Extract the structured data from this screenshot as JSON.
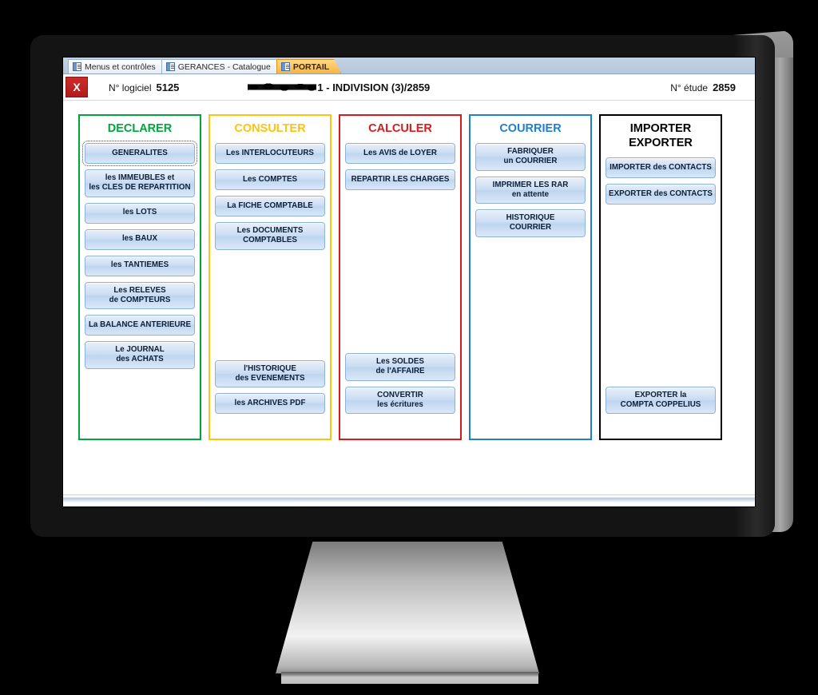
{
  "window": {
    "doc_tabs": [
      {
        "label": "Menus et contrôles",
        "active": false
      },
      {
        "label": "GERANCES - Catalogue",
        "active": false
      },
      {
        "label": "PORTAIL",
        "active": true
      }
    ],
    "close_button_label": "X",
    "header": {
      "software_label": "N° logiciel",
      "software_value": "5125",
      "title_redacted_suffix": "1 - INDIVISION (3)/2859",
      "study_label": "N° étude",
      "study_value": "2859"
    }
  },
  "panels": [
    {
      "title": "DECLARER",
      "color": "#00a63c",
      "title_color": "#00a63c",
      "buttons": [
        {
          "label": "GENERALITES",
          "focused": true
        },
        {
          "label": "les IMMEUBLES et\nles CLES DE REPARTITION",
          "focused": false
        },
        {
          "label": "les LOTS",
          "focused": false
        },
        {
          "label": "les BAUX",
          "focused": false
        },
        {
          "label": "les TANTIEMES",
          "focused": false
        },
        {
          "label": "Les RELEVES\nde COMPTEURS",
          "focused": false
        },
        {
          "label": "La BALANCE ANTERIEURE",
          "focused": false
        },
        {
          "label": "Le JOURNAL\ndes ACHATS",
          "focused": false
        }
      ]
    },
    {
      "title": "CONSULTER",
      "color": "#ffc20e",
      "title_color": "#ffc20e",
      "buttons": [
        {
          "label": "Les INTERLOCUTEURS",
          "focused": false
        },
        {
          "label": "Les COMPTES",
          "focused": false
        },
        {
          "label": "La FICHE COMPTABLE",
          "focused": false
        },
        {
          "label": "Les DOCUMENTS\nCOMPTABLES",
          "focused": false
        }
      ],
      "bottom_buttons": [
        {
          "label": "l'HISTORIQUE\ndes EVENEMENTS",
          "focused": false
        },
        {
          "label": "les ARCHIVES PDF",
          "focused": false
        }
      ]
    },
    {
      "title": "CALCULER",
      "color": "#d91a1a",
      "title_color": "#d91a1a",
      "buttons": [
        {
          "label": "Les AVIS de LOYER",
          "focused": false
        },
        {
          "label": "REPARTIR LES CHARGES",
          "focused": false
        }
      ],
      "bottom_buttons": [
        {
          "label": "Les SOLDES\nde l'AFFAIRE",
          "focused": false
        },
        {
          "label": "CONVERTIR\nles écritures",
          "focused": false
        }
      ]
    },
    {
      "title": "COURRIER",
      "color": "#1d7fd4",
      "title_color": "#1d7fd4",
      "buttons": [
        {
          "label": "FABRIQUER\nun COURRIER",
          "focused": false
        },
        {
          "label": "IMPRIMER LES RAR\nen attente",
          "focused": false
        },
        {
          "label": "HISTORIQUE\nCOURRIER",
          "focused": false
        }
      ]
    },
    {
      "title": "IMPORTER\nEXPORTER",
      "color": "#000000",
      "title_color": "#000000",
      "buttons": [
        {
          "label": "IMPORTER des CONTACTS",
          "focused": false
        },
        {
          "label": "EXPORTER des CONTACTS",
          "focused": false
        }
      ],
      "bottom_buttons": [
        {
          "label": "EXPORTER la\nCOMPTA COPPELIUS",
          "focused": false
        }
      ]
    }
  ]
}
